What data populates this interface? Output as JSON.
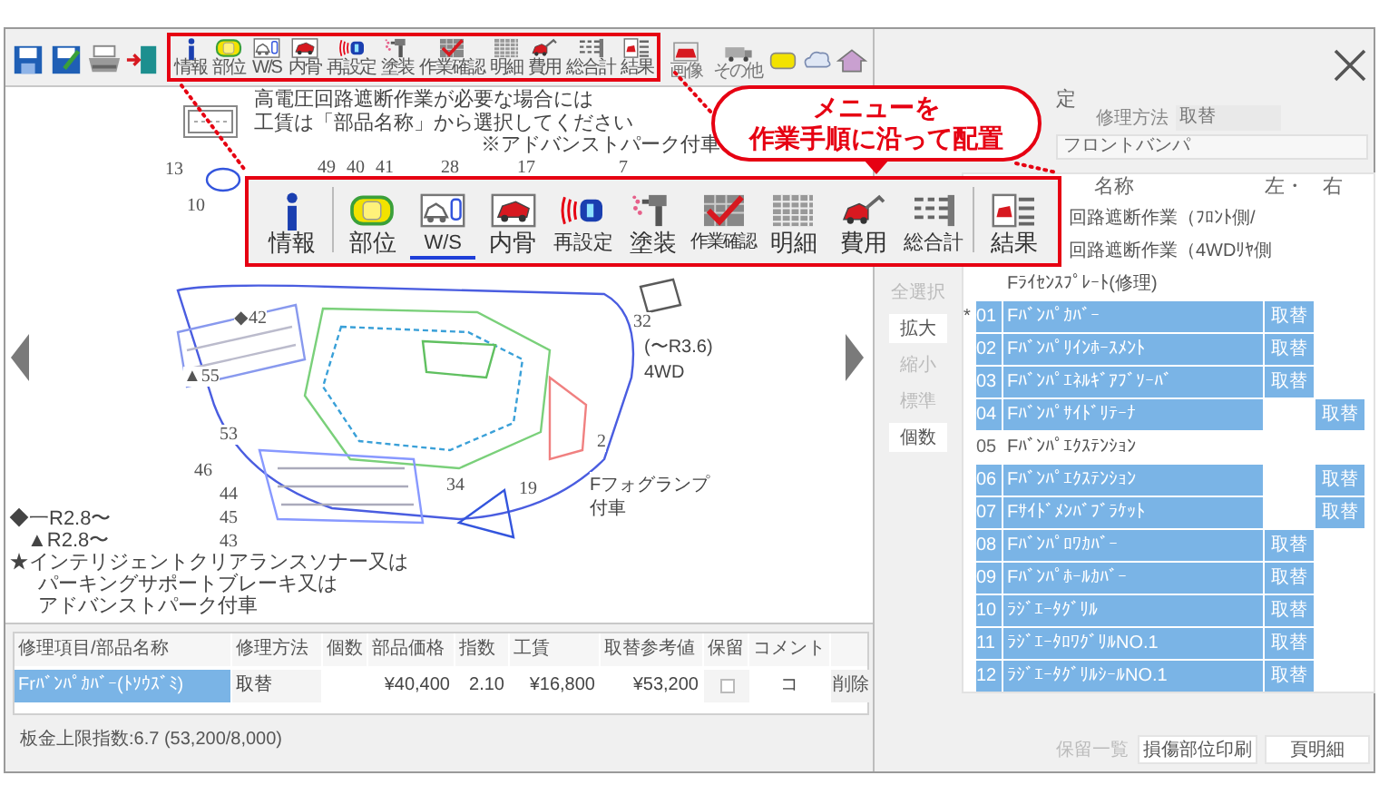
{
  "toolbar": {
    "menu_items": [
      {
        "label": "情報"
      },
      {
        "label": "部位"
      },
      {
        "label": "W/S"
      },
      {
        "label": "内骨"
      },
      {
        "label": "再設定"
      },
      {
        "label": "塗装"
      },
      {
        "label": "作業確認"
      },
      {
        "label": "明細"
      },
      {
        "label": "費用"
      },
      {
        "label": "総合計"
      },
      {
        "label": "結果"
      }
    ],
    "extra_items": [
      {
        "label": "画像"
      },
      {
        "label": "その他"
      }
    ]
  },
  "magnified_menu": {
    "items": [
      {
        "label": "情報",
        "selected": false
      },
      {
        "label": "部位",
        "selected": false
      },
      {
        "label": "W/S",
        "selected": true
      },
      {
        "label": "内骨",
        "selected": false
      },
      {
        "label": "再設定",
        "selected": false
      },
      {
        "label": "塗装",
        "selected": false
      },
      {
        "label": "作業確認",
        "selected": false
      },
      {
        "label": "明細",
        "selected": false
      },
      {
        "label": "費用",
        "selected": false
      },
      {
        "label": "総合計",
        "selected": false
      },
      {
        "label": "結果",
        "selected": false
      }
    ]
  },
  "bubble": {
    "lines": [
      "メニューを",
      "作業手順に沿って配置"
    ]
  },
  "diagram": {
    "notes_top": [
      "高電圧回路遮断作業が必要な場合には",
      "工賃は「部品名称」から選択してください",
      "※アドバンストパーク付車"
    ],
    "numbers": [
      "13",
      "10",
      "49",
      "40",
      "41",
      "28",
      "17",
      "7",
      "◆42",
      "▲55",
      "53",
      "46",
      "44",
      "45",
      "43",
      "34",
      "19",
      "2",
      "32"
    ],
    "labels": [
      "(〜R3.6)",
      "4WD",
      "Fフォグランプ",
      "付車"
    ],
    "notes_bottom": [
      "◆一R2.8〜",
      "▲R2.8〜",
      "★インテリジェントクリアランスソナー又は",
      "パーキングサポートブレーキ又は",
      "アドバンストパーク付車"
    ]
  },
  "right_panel": {
    "setting_label": "定",
    "repair_method_label": "修理方法",
    "repair_method": "取替",
    "part_group": "フロントバンパ",
    "columns": [
      "名称",
      "左・",
      "右"
    ],
    "side_buttons": [
      {
        "label": "全選択",
        "disabled": true
      },
      {
        "label": "拡大",
        "disabled": false
      },
      {
        "label": "縮小",
        "disabled": true
      },
      {
        "label": "標準",
        "disabled": true
      },
      {
        "label": "個数",
        "disabled": false
      }
    ],
    "rows": [
      {
        "kind": "covered",
        "name": "回路遮断作業（ﾌﾛﾝﾄ側/",
        "selected": false
      },
      {
        "kind": "covered",
        "name": "回路遮断作業（4WDﾘﾔ側",
        "selected": false
      },
      {
        "kind": "plain",
        "name": "Fﾗｲｾﾝｽﾌﾟﾚｰﾄ(修理)",
        "selected": false
      },
      {
        "kind": "part",
        "marker": "*",
        "no": "01",
        "name": "Fﾊﾞﾝﾊﾟｶﾊﾞｰ",
        "left": "取替",
        "selected": true
      },
      {
        "kind": "part",
        "no": "02",
        "name": "Fﾊﾞﾝﾊﾟﾘｲﾝﾎｰｽﾒﾝﾄ",
        "left": "取替",
        "selected": true
      },
      {
        "kind": "part",
        "no": "03",
        "name": "Fﾊﾞﾝﾊﾟｴﾈﾙｷﾞｱﾌﾞｿｰﾊﾞ",
        "left": "取替",
        "selected": true
      },
      {
        "kind": "part",
        "no": "04",
        "name": "Fﾊﾞﾝﾊﾟｻｲﾄﾞﾘﾃｰﾅ",
        "right": "取替",
        "selected": true
      },
      {
        "kind": "part",
        "no": "05",
        "name": "Fﾊﾞﾝﾊﾟｴｸｽﾃﾝｼｮﾝ",
        "selected": false
      },
      {
        "kind": "part",
        "no": "06",
        "name": "Fﾊﾞﾝﾊﾟｴｸｽﾃﾝｼｮﾝ",
        "right": "取替",
        "selected": true
      },
      {
        "kind": "part",
        "no": "07",
        "name": "Fｻｲﾄﾞﾒﾝﾊﾞﾌﾞﾗｹｯﾄ",
        "right": "取替",
        "selected": true
      },
      {
        "kind": "part",
        "no": "08",
        "name": "Fﾊﾞﾝﾊﾟﾛﾜｶﾊﾞｰ",
        "left": "取替",
        "selected": true
      },
      {
        "kind": "part",
        "no": "09",
        "name": "Fﾊﾞﾝﾊﾟﾎｰﾙｶﾊﾞｰ",
        "left": "取替",
        "selected": true
      },
      {
        "kind": "part",
        "no": "10",
        "name": "ﾗｼﾞｴｰﾀｸﾞﾘﾙ",
        "left": "取替",
        "selected": true
      },
      {
        "kind": "part",
        "no": "11",
        "name": "ﾗｼﾞｴｰﾀﾛﾜｸﾞﾘﾙNO.1",
        "left": "取替",
        "selected": true
      },
      {
        "kind": "part",
        "no": "12",
        "name": "ﾗｼﾞｴｰﾀｸﾞﾘﾙｼｰﾙNO.1",
        "left": "取替",
        "selected": true
      }
    ],
    "bottom_buttons": [
      {
        "label": "保留一覧",
        "disabled": true
      },
      {
        "label": "損傷部位印刷",
        "disabled": false
      },
      {
        "label": "頁明細",
        "disabled": false
      }
    ]
  },
  "estimate_table": {
    "columns": [
      "修理項目/部品名称",
      "修理方法",
      "個数",
      "部品価格",
      "指数",
      "工賃",
      "取替参考値",
      "保留",
      "コメント"
    ],
    "rows": [
      {
        "name": "Frﾊﾞﾝﾊﾟｶﾊﾞｰ(ﾄｿｳｽﾞﾐ)",
        "method": "取替",
        "part_price": "¥40,400",
        "index": "2.10",
        "labor": "¥16,800",
        "reference": "¥53,200",
        "hold": false,
        "comment": "コ",
        "action": "削除",
        "selected": true
      }
    ],
    "summary": "板金上限指数:6.7 (53,200/8,000)"
  }
}
